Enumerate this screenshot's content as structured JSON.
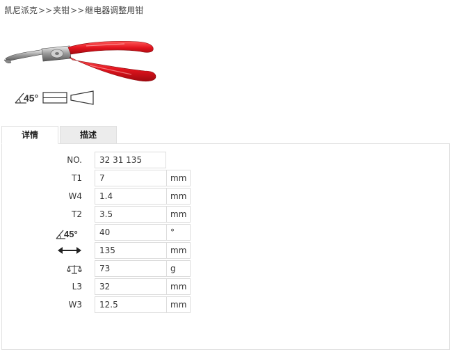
{
  "breadcrumb": {
    "items": [
      "凯尼派克",
      "夹钳",
      "继电器调整用钳"
    ],
    "separator": ">>"
  },
  "product": {
    "image_icon": "pliers-icon",
    "feature_icons": [
      "angle-45-icon",
      "flat-jaw-icon",
      "tapered-jaw-icon"
    ],
    "angle_text": "45°"
  },
  "tabs": [
    {
      "label": "详情",
      "active": true
    },
    {
      "label": "描述",
      "active": false
    }
  ],
  "specs": [
    {
      "label": "NO.",
      "value": "32 31 135",
      "unit": null
    },
    {
      "label": "T1",
      "value": "7",
      "unit": "mm"
    },
    {
      "label": "W4",
      "value": "1.4",
      "unit": "mm"
    },
    {
      "label": "T2",
      "value": "3.5",
      "unit": "mm"
    },
    {
      "label": "45°",
      "icon": "angle-45-icon",
      "value": "40",
      "unit": "°"
    },
    {
      "label": "",
      "icon": "length-arrow-icon",
      "value": "135",
      "unit": "mm"
    },
    {
      "label": "",
      "icon": "scale-weight-icon",
      "value": "73",
      "unit": "g"
    },
    {
      "label": "L3",
      "value": "32",
      "unit": "mm"
    },
    {
      "label": "W3",
      "value": "12.5",
      "unit": "mm"
    }
  ],
  "colors": {
    "handle_red": "#e3141e",
    "tab_inactive_bg": "#ececec",
    "border": "#dcdcdc"
  }
}
